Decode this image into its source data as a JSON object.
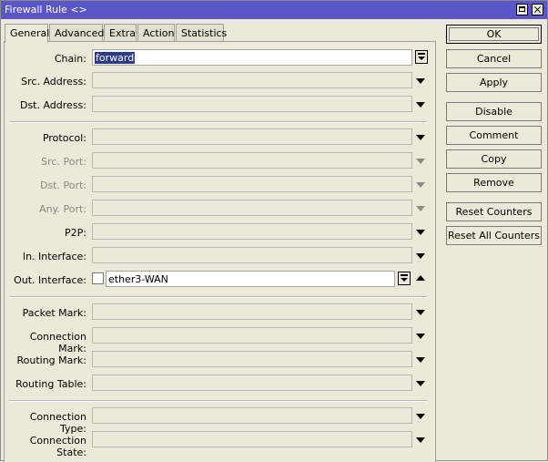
{
  "window": {
    "title": "Firewall Rule <>"
  },
  "tabs": [
    {
      "label": "General",
      "active": true
    },
    {
      "label": "Advanced",
      "active": false
    },
    {
      "label": "Extra",
      "active": false
    },
    {
      "label": "Action",
      "active": false
    },
    {
      "label": "Statistics",
      "active": false
    }
  ],
  "fields": {
    "chain": {
      "label": "Chain:",
      "value": "forward"
    },
    "src_address": {
      "label": "Src. Address:",
      "value": ""
    },
    "dst_address": {
      "label": "Dst. Address:",
      "value": ""
    },
    "protocol": {
      "label": "Protocol:",
      "value": ""
    },
    "src_port": {
      "label": "Src. Port:",
      "value": "",
      "disabled": true
    },
    "dst_port": {
      "label": "Dst. Port:",
      "value": "",
      "disabled": true
    },
    "any_port": {
      "label": "Any. Port:",
      "value": "",
      "disabled": true
    },
    "p2p": {
      "label": "P2P:",
      "value": ""
    },
    "in_interface": {
      "label": "In. Interface:",
      "value": ""
    },
    "out_interface": {
      "label": "Out. Interface:",
      "value": "ether3-WAN",
      "negate": false
    },
    "packet_mark": {
      "label": "Packet Mark:",
      "value": ""
    },
    "connection_mark": {
      "label": "Connection Mark:",
      "value": ""
    },
    "routing_mark": {
      "label": "Routing Mark:",
      "value": ""
    },
    "routing_table": {
      "label": "Routing Table:",
      "value": ""
    },
    "connection_type": {
      "label": "Connection Type:",
      "value": ""
    },
    "connection_state": {
      "label": "Connection State:",
      "value": ""
    }
  },
  "buttons": {
    "ok": "OK",
    "cancel": "Cancel",
    "apply": "Apply",
    "disable": "Disable",
    "comment": "Comment",
    "copy": "Copy",
    "remove": "Remove",
    "reset_counters": "Reset Counters",
    "reset_all_counters": "Reset All Counters"
  },
  "colors": {
    "titlebar": "#5a55c8",
    "window_bg": "#ece9d8",
    "selection": "#2c3a8c"
  }
}
